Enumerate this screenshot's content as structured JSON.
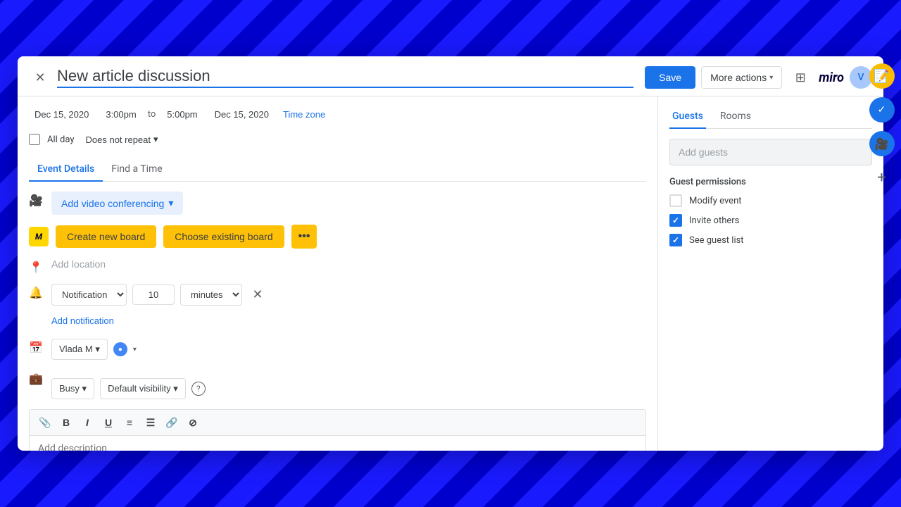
{
  "background": {
    "color": "#1a1aff"
  },
  "modal": {
    "title": "New article discussion",
    "close_label": "×"
  },
  "header": {
    "save_label": "Save",
    "more_actions_label": "More actions",
    "miro_label": "miro",
    "apps_icon": "⊞"
  },
  "datetime": {
    "start_date": "Dec 15, 2020",
    "start_time": "3:00pm",
    "to_label": "to",
    "end_time": "5:00pm",
    "end_date": "Dec 15, 2020",
    "timezone_label": "Time zone"
  },
  "allday": {
    "label": "All day",
    "repeat_label": "Does not repeat",
    "repeat_arrow": "▾"
  },
  "tabs": {
    "event_details": "Event Details",
    "find_a_time": "Find a Time"
  },
  "video_conf": {
    "label": "Add video conferencing",
    "arrow": "▾"
  },
  "miro": {
    "logo": "M",
    "create_new": "Create new board",
    "choose_existing": "Choose existing board",
    "more": "•••"
  },
  "location": {
    "placeholder": "Add location"
  },
  "notification": {
    "type_label": "Notification",
    "value": "10",
    "unit_label": "minutes",
    "remove": "×",
    "add_label": "Add notification"
  },
  "calendar": {
    "owner_label": "Vlada M",
    "owner_arrow": "▾",
    "color_label": "●",
    "color_arrow": "▾"
  },
  "status": {
    "busy_label": "Busy",
    "busy_arrow": "▾",
    "visibility_label": "Default visibility",
    "visibility_arrow": "▾",
    "help": "?"
  },
  "description": {
    "placeholder": "Add description",
    "toolbar": {
      "attach": "📎",
      "bold": "B",
      "italic": "I",
      "underline": "U",
      "ordered_list": "≡",
      "unordered_list": "☰",
      "link": "🔗",
      "remove_format": "⊘"
    }
  },
  "guests_panel": {
    "guests_tab": "Guests",
    "rooms_tab": "Rooms",
    "add_guests_placeholder": "Add guests",
    "permissions_title": "Guest permissions",
    "permissions": [
      {
        "label": "Modify event",
        "checked": false
      },
      {
        "label": "Invite others",
        "checked": true
      },
      {
        "label": "See guest list",
        "checked": true
      }
    ]
  },
  "sidebar_icons": [
    {
      "name": "note-icon",
      "symbol": "📝",
      "style": "yellow"
    },
    {
      "name": "check-icon",
      "symbol": "✓",
      "style": "blue-check"
    },
    {
      "name": "video-icon",
      "symbol": "🎥",
      "style": "video-blue"
    },
    {
      "name": "plus-icon",
      "symbol": "+",
      "style": "plus"
    }
  ]
}
